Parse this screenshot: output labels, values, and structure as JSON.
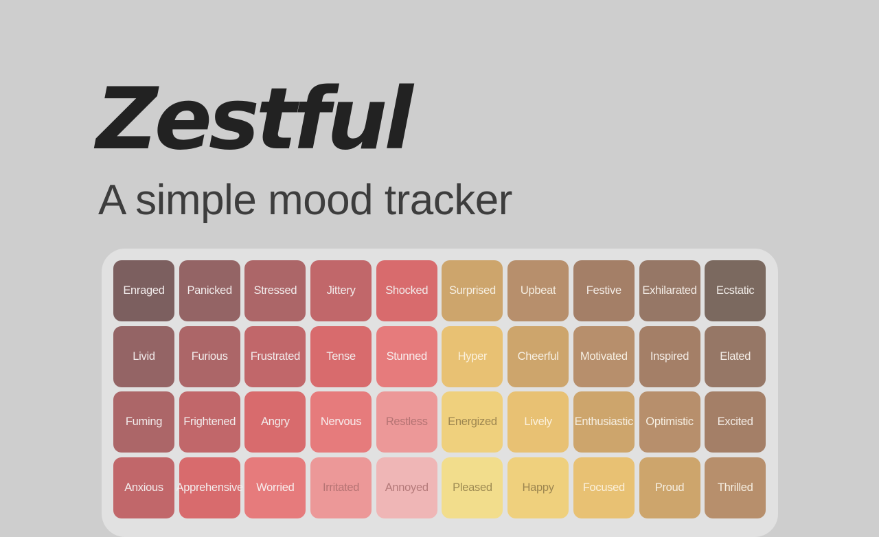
{
  "app": {
    "title": "Zestful",
    "subtitle": "A simple mood tracker"
  },
  "colors": {
    "background": "#cecece",
    "panel": "#e1e1e1",
    "title": "#222222",
    "subtitle": "#3d3d3d"
  },
  "mood_grid": {
    "rows": [
      [
        {
          "label": "Enraged",
          "color": "#7c5f5f",
          "text_color": "#f2ecec"
        },
        {
          "label": "Panicked",
          "color": "#946465",
          "text_color": "#f2ecec"
        },
        {
          "label": "Stressed",
          "color": "#ac6668",
          "text_color": "#f2ecec"
        },
        {
          "label": "Jittery",
          "color": "#c1676a",
          "text_color": "#f2ecec"
        },
        {
          "label": "Shocked",
          "color": "#d86b6d",
          "text_color": "#f2ecec"
        },
        {
          "label": "Surprised",
          "color": "#cda56c",
          "text_color": "#f6efe2"
        },
        {
          "label": "Upbeat",
          "color": "#b78f6c",
          "text_color": "#f6efe2"
        },
        {
          "label": "Festive",
          "color": "#a47f67",
          "text_color": "#f3ece6"
        },
        {
          "label": "Exhilarated",
          "color": "#967766",
          "text_color": "#f3ece6"
        },
        {
          "label": "Ecstatic",
          "color": "#7b695f",
          "text_color": "#f0ebe7"
        }
      ],
      [
        {
          "label": "Livid",
          "color": "#946465",
          "text_color": "#f2ecec"
        },
        {
          "label": "Furious",
          "color": "#ac6668",
          "text_color": "#f2ecec"
        },
        {
          "label": "Frustrated",
          "color": "#c1676a",
          "text_color": "#f2ecec"
        },
        {
          "label": "Tense",
          "color": "#d86b6d",
          "text_color": "#f2ecec"
        },
        {
          "label": "Stunned",
          "color": "#e67b7c",
          "text_color": "#f8eeee"
        },
        {
          "label": "Hyper",
          "color": "#e8c173",
          "text_color": "#fbf1dd"
        },
        {
          "label": "Cheerful",
          "color": "#cda56c",
          "text_color": "#f6efe2"
        },
        {
          "label": "Motivated",
          "color": "#b78f6c",
          "text_color": "#f6efe2"
        },
        {
          "label": "Inspired",
          "color": "#a47f67",
          "text_color": "#f3ece6"
        },
        {
          "label": "Elated",
          "color": "#967766",
          "text_color": "#f3ece6"
        }
      ],
      [
        {
          "label": "Fuming",
          "color": "#ac6668",
          "text_color": "#f2ecec"
        },
        {
          "label": "Frightened",
          "color": "#c1676a",
          "text_color": "#f2ecec"
        },
        {
          "label": "Angry",
          "color": "#d86b6d",
          "text_color": "#f2ecec"
        },
        {
          "label": "Nervous",
          "color": "#e67b7c",
          "text_color": "#f8eeee"
        },
        {
          "label": "Restless",
          "color": "#ec9898",
          "text_color": "#b57373"
        },
        {
          "label": "Energized",
          "color": "#efd07d",
          "text_color": "#9d8650"
        },
        {
          "label": "Lively",
          "color": "#e8c173",
          "text_color": "#fbf1dd"
        },
        {
          "label": "Enthusiastic",
          "color": "#cda56c",
          "text_color": "#f6efe2"
        },
        {
          "label": "Optimistic",
          "color": "#b78f6c",
          "text_color": "#f6efe2"
        },
        {
          "label": "Excited",
          "color": "#a47f67",
          "text_color": "#f3ece6"
        }
      ],
      [
        {
          "label": "Anxious",
          "color": "#c1676a",
          "text_color": "#f2ecec"
        },
        {
          "label": "Apprehensive",
          "color": "#d86b6d",
          "text_color": "#f2ecec"
        },
        {
          "label": "Worried",
          "color": "#e67b7c",
          "text_color": "#f8eeee"
        },
        {
          "label": "Irritated",
          "color": "#ec9898",
          "text_color": "#b57373"
        },
        {
          "label": "Annoyed",
          "color": "#efb6b6",
          "text_color": "#b57a7a"
        },
        {
          "label": "Pleased",
          "color": "#f2dd8c",
          "text_color": "#9d8a52"
        },
        {
          "label": "Happy",
          "color": "#efd07d",
          "text_color": "#9d8650"
        },
        {
          "label": "Focused",
          "color": "#e8c173",
          "text_color": "#fbf1dd"
        },
        {
          "label": "Proud",
          "color": "#cda56c",
          "text_color": "#f6efe2"
        },
        {
          "label": "Thrilled",
          "color": "#b78f6c",
          "text_color": "#f6efe2"
        }
      ]
    ]
  }
}
